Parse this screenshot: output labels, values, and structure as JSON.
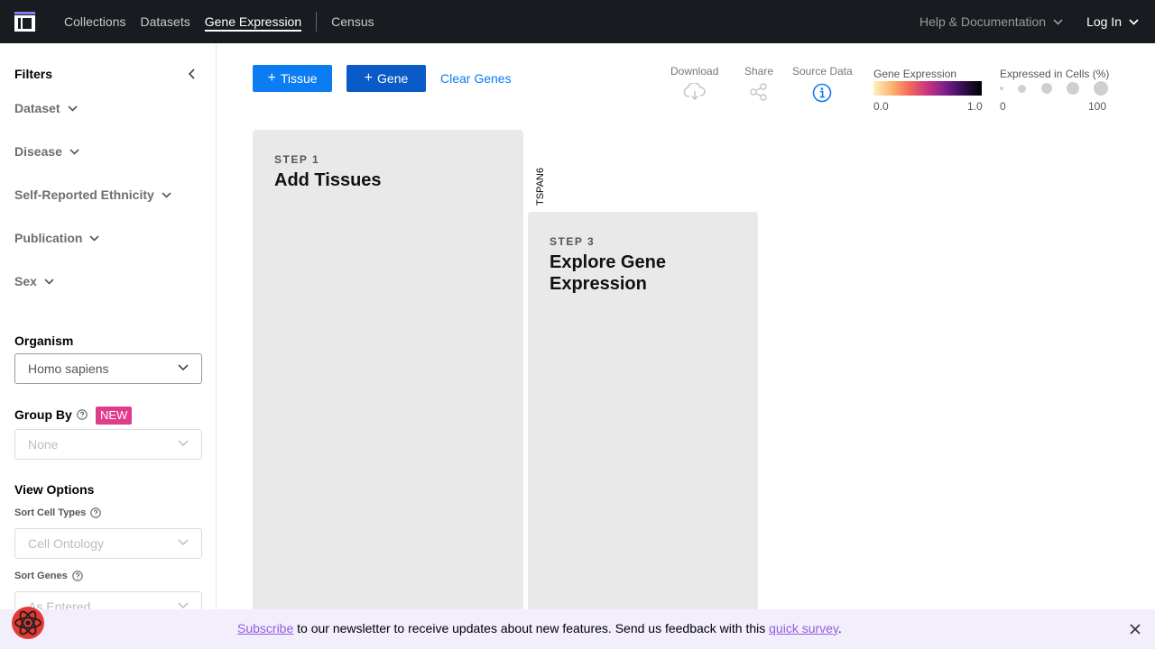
{
  "nav": {
    "links": [
      "Collections",
      "Datasets",
      "Gene Expression",
      "Census"
    ],
    "help": "Help & Documentation",
    "login": "Log In"
  },
  "sidebar": {
    "title": "Filters",
    "filters": [
      "Dataset",
      "Disease",
      "Self-Reported Ethnicity",
      "Publication",
      "Sex"
    ],
    "organism": {
      "label": "Organism",
      "value": "Homo sapiens"
    },
    "group_by": {
      "label": "Group By",
      "badge": "NEW",
      "value": "None"
    },
    "view_options": {
      "label": "View Options",
      "sort_cell_types": {
        "label": "Sort Cell Types",
        "value": "Cell Ontology"
      },
      "sort_genes": {
        "label": "Sort Genes",
        "value": "As Entered"
      }
    }
  },
  "toolbar": {
    "tissue": "Tissue",
    "gene": "Gene",
    "clear": "Clear Genes",
    "download": "Download",
    "share": "Share",
    "source": "Source Data"
  },
  "legend": {
    "expression": {
      "label": "Gene Expression",
      "min": "0.0",
      "max": "1.0"
    },
    "cells": {
      "label": "Expressed in Cells (%)",
      "min": "0",
      "max": "100"
    }
  },
  "steps": {
    "step1": {
      "label": "STEP 1",
      "title": "Add Tissues"
    },
    "step3": {
      "label": "STEP 3",
      "title": "Explore Gene Expression"
    }
  },
  "gene": "TSPAN6",
  "banner": {
    "link1": "Subscribe",
    "middle": " to our newsletter to receive updates about new features. Send us feedback with this ",
    "link2": "quick survey",
    "end": "."
  },
  "colors": {
    "primary": "#0b7cf2",
    "gene_button": "#0a5ac7",
    "badge": "#e13b8b",
    "banner": "#f3eefc"
  }
}
